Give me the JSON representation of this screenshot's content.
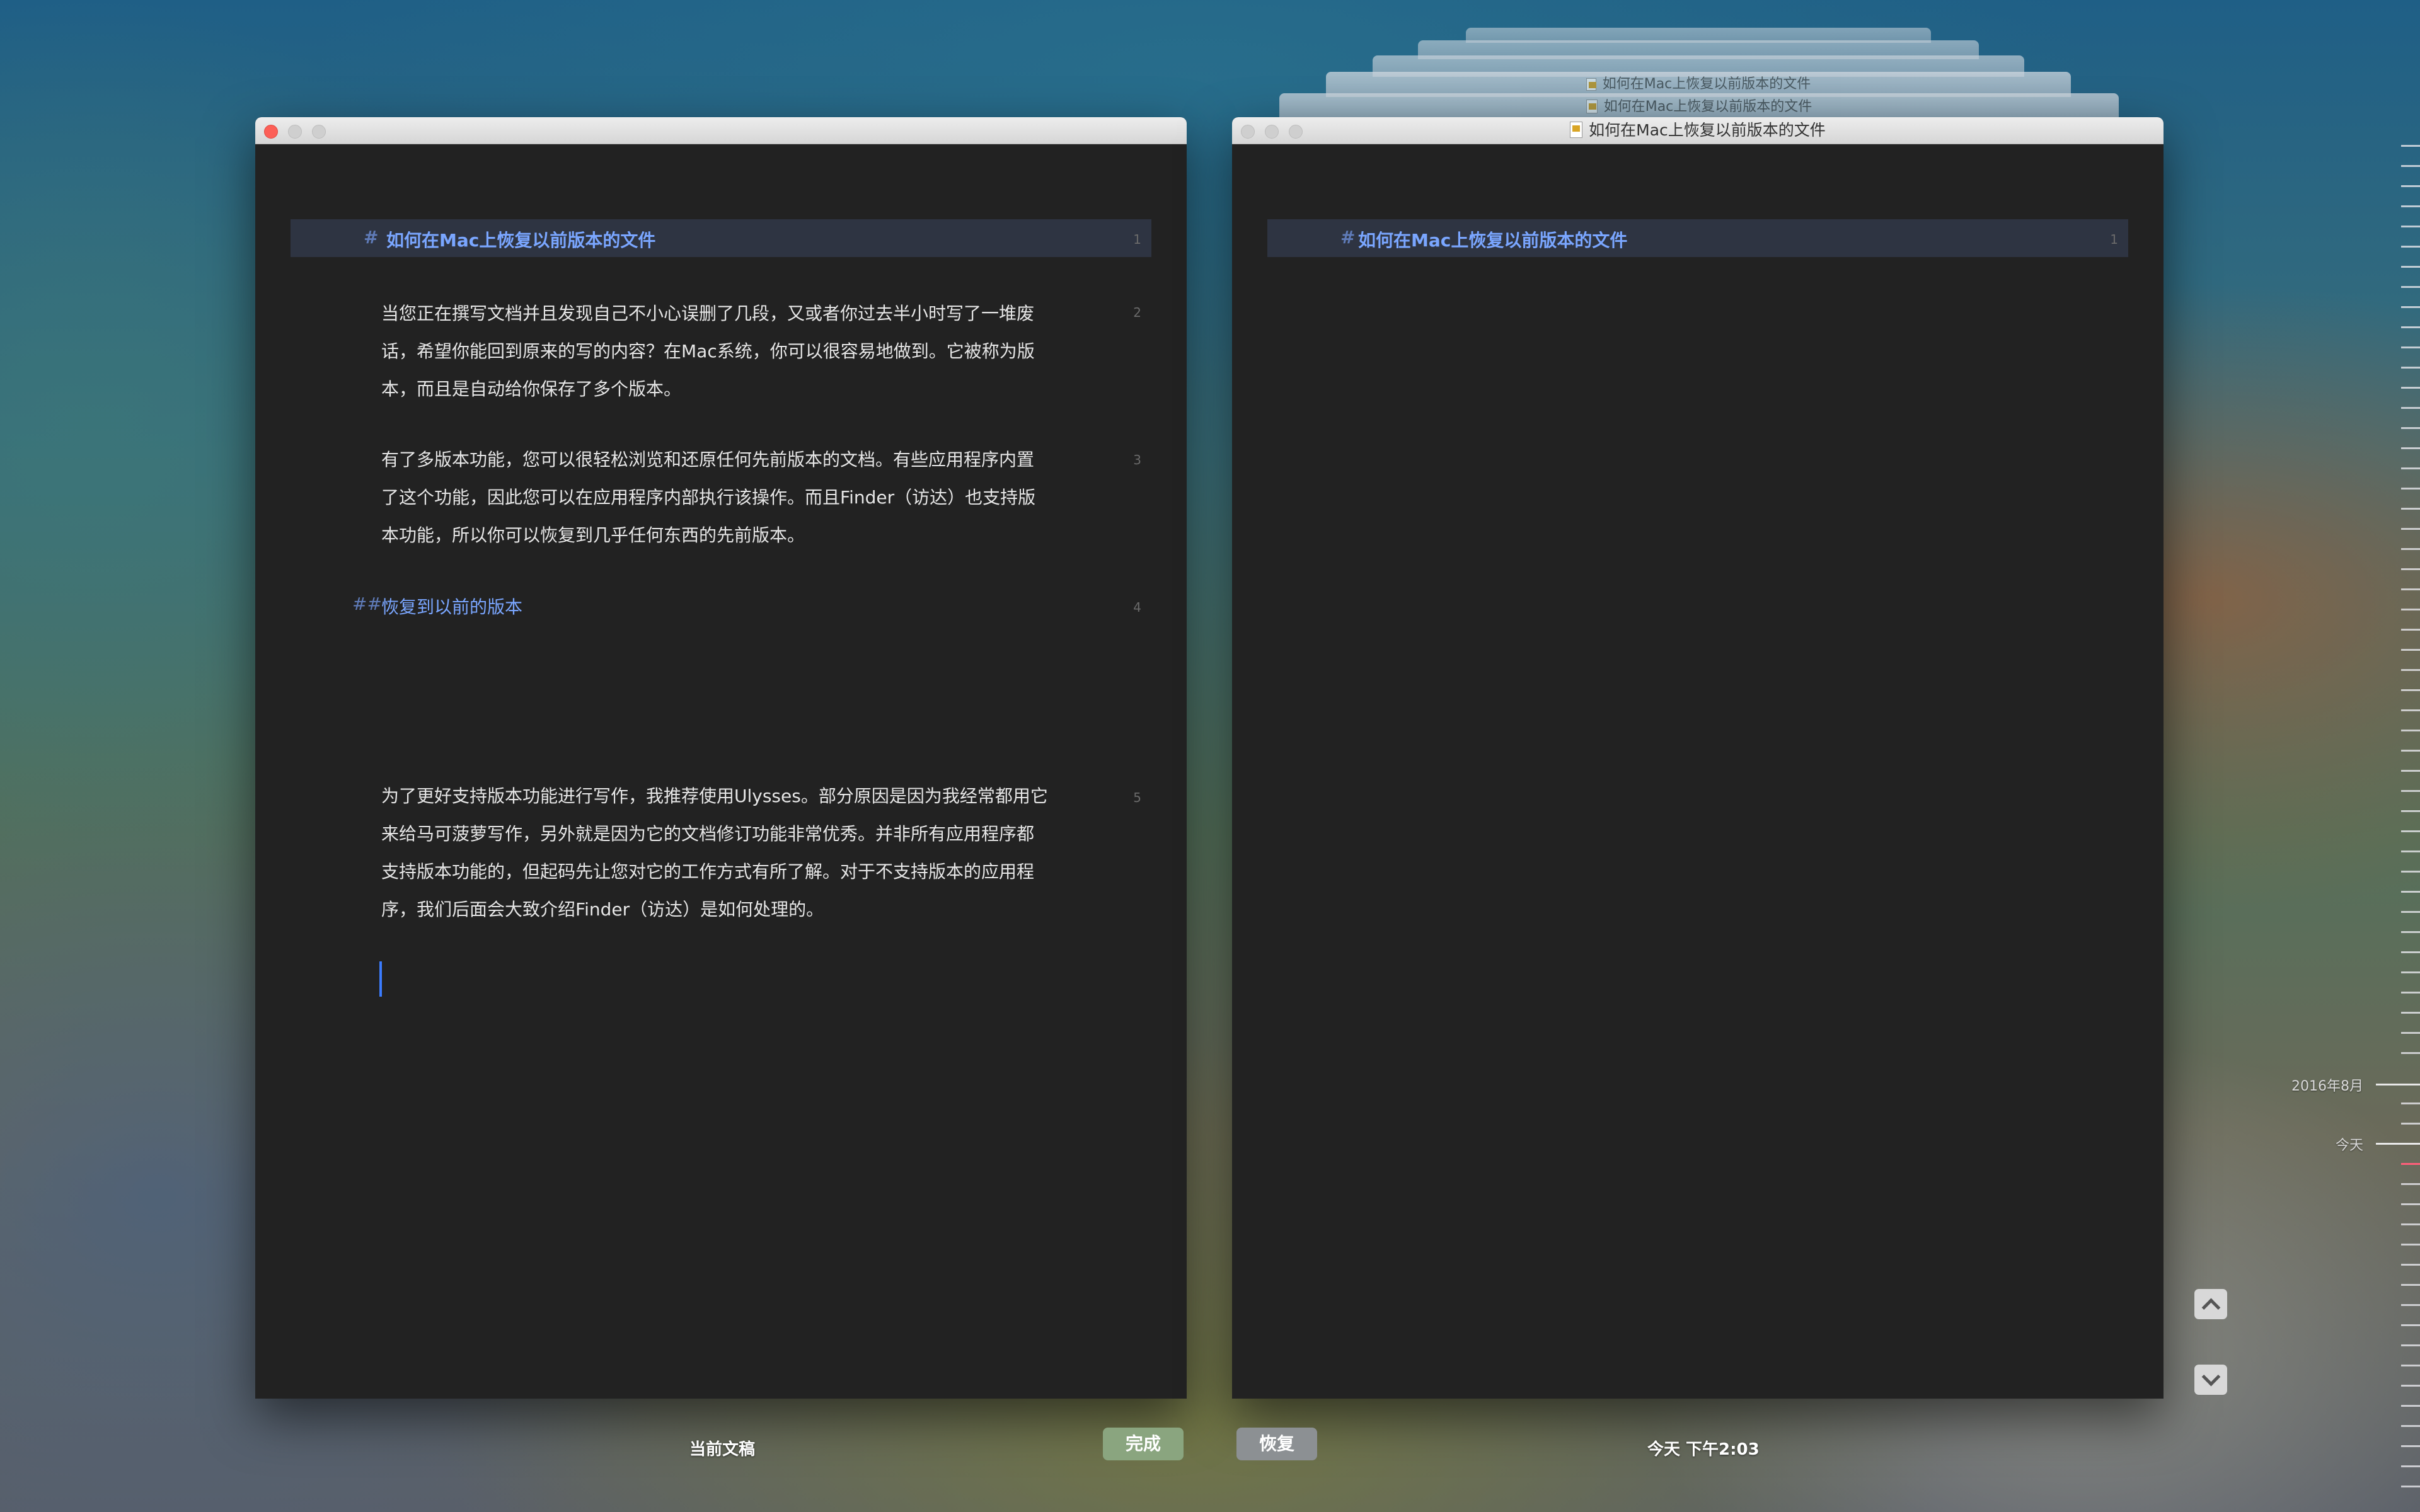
{
  "doc_title": "如何在Mac上恢复以前版本的文件",
  "left_pane": {
    "heading1": {
      "mark": "#",
      "text": "如何在Mac上恢复以前版本的文件",
      "line": "1"
    },
    "para1": {
      "text": "当您正在撰写文档并且发现自己不小心误删了几段，又或者你过去半小时写了一堆废话，希望你能回到原来的写的内容？在Mac系统，你可以很容易地做到。它被称为版本，而且是自动给你保存了多个版本。",
      "line": "2"
    },
    "para2": {
      "text": "有了多版本功能，您可以很轻松浏览和还原任何先前版本的文档。有些应用程序内置了这个功能，因此您可以在应用程序内部执行该操作。而且Finder（访达）也支持版本功能，所以你可以恢复到几乎任何东西的先前版本。",
      "line": "3"
    },
    "heading2": {
      "mark": "##",
      "text": "恢复到以前的版本",
      "line": "4"
    },
    "para3": {
      "text": "为了更好支持版本功能进行写作，我推荐使用Ulysses。部分原因是因为我经常都用它来给马可菠萝写作，另外就是因为它的文档修订功能非常优秀。并非所有应用程序都支持版本功能的，但起码先让您对它的工作方式有所了解。对于不支持版本的应用程序，我们后面会大致介绍Finder（访达）是如何处理的。",
      "line": "5"
    }
  },
  "right_pane": {
    "heading1": {
      "mark": "#",
      "text": "如何在Mac上恢复以前版本的文件",
      "line": "1"
    }
  },
  "bottom": {
    "current_label": "当前文稿",
    "done_label": "完成",
    "restore_label": "恢复",
    "version_time": "今天 下午2:03"
  },
  "timeline": {
    "month_label": "2016年8月",
    "today_label": "今天"
  },
  "icons": {
    "doc": "document-icon",
    "up": "chevron-up-icon",
    "down": "chevron-down-icon"
  },
  "colors": {
    "heading": "#7aa6ff",
    "done_button": "#8aa57f",
    "restore_button": "#8c9093",
    "editor_bg": "#222222"
  }
}
